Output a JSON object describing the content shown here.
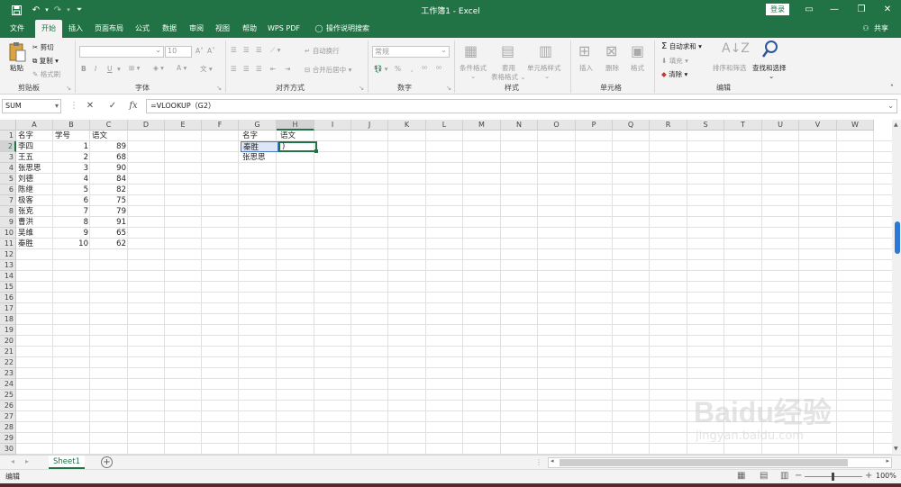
{
  "window": {
    "title": "工作簿1 - Excel",
    "login_label": "登录",
    "share_label": "共享"
  },
  "tabs": [
    {
      "label": "文件",
      "active": false
    },
    {
      "label": "开始",
      "active": true
    },
    {
      "label": "插入",
      "active": false
    },
    {
      "label": "页面布局",
      "active": false
    },
    {
      "label": "公式",
      "active": false
    },
    {
      "label": "数据",
      "active": false
    },
    {
      "label": "审阅",
      "active": false
    },
    {
      "label": "视图",
      "active": false
    },
    {
      "label": "帮助",
      "active": false
    },
    {
      "label": "WPS PDF",
      "active": false
    }
  ],
  "tell_me": "操作说明搜索",
  "ribbon": {
    "clipboard": {
      "label": "剪贴板",
      "paste": "粘贴",
      "cut": "剪切",
      "copy": "复制",
      "format_painter": "格式刷"
    },
    "font": {
      "label": "字体",
      "size": "10",
      "bold": "B",
      "italic": "I",
      "underline": "U"
    },
    "alignment": {
      "label": "对齐方式",
      "wrap": "自动换行",
      "merge": "合并后居中"
    },
    "number": {
      "label": "数字",
      "format": "常规",
      "percent": "%",
      "comma": ","
    },
    "styles": {
      "label": "样式",
      "conditional": "条件格式",
      "table": "套用\n表格格式",
      "cell_styles": "单元格样式"
    },
    "cells": {
      "label": "单元格",
      "insert": "插入",
      "delete": "删除",
      "format": "格式"
    },
    "editing": {
      "label": "编辑",
      "autosum": "自动求和",
      "fill": "填充",
      "clear": "清除",
      "sort": "排序和筛选",
      "find": "查找和选择"
    }
  },
  "formula_bar": {
    "name_box": "SUM",
    "formula": "=VLOOKUP（G2）",
    "cancel": "✕",
    "enter": "✓",
    "fx": "fx"
  },
  "grid": {
    "columns": [
      "A",
      "B",
      "C",
      "D",
      "E",
      "F",
      "G",
      "H",
      "I",
      "J",
      "K",
      "L",
      "M",
      "N",
      "O",
      "P",
      "Q",
      "R",
      "S",
      "T",
      "U",
      "V",
      "W"
    ],
    "rows": [
      "1",
      "2",
      "3",
      "4",
      "5",
      "6",
      "7",
      "8",
      "9",
      "10",
      "11",
      "12",
      "13",
      "14",
      "15",
      "16",
      "17",
      "18",
      "19",
      "20",
      "21",
      "22",
      "23",
      "24",
      "25",
      "26",
      "27",
      "28",
      "29",
      "30"
    ],
    "selected_col": "H",
    "selected_row": "2",
    "table": [
      [
        "名字",
        "学号",
        "语文"
      ],
      [
        "李四",
        "1",
        "89"
      ],
      [
        "王五",
        "2",
        "68"
      ],
      [
        "张思思",
        "3",
        "90"
      ],
      [
        "刘德",
        "4",
        "84"
      ],
      [
        "陈继",
        "5",
        "82"
      ],
      [
        "极客",
        "6",
        "75"
      ],
      [
        "张克",
        "7",
        "79"
      ],
      [
        "曹洪",
        "8",
        "91"
      ],
      [
        "吴维",
        "9",
        "65"
      ],
      [
        "秦胜",
        "10",
        "62"
      ]
    ],
    "lookup": {
      "g1": "名字",
      "h1": "语文",
      "g2": "秦胜",
      "h2": ")",
      "g3": "张思思"
    }
  },
  "sheets": {
    "active": "Sheet1"
  },
  "status": {
    "mode": "编辑",
    "zoom": "100%"
  },
  "watermark": {
    "brand": "Baidu经验",
    "url": "jingyan.baidu.com"
  }
}
